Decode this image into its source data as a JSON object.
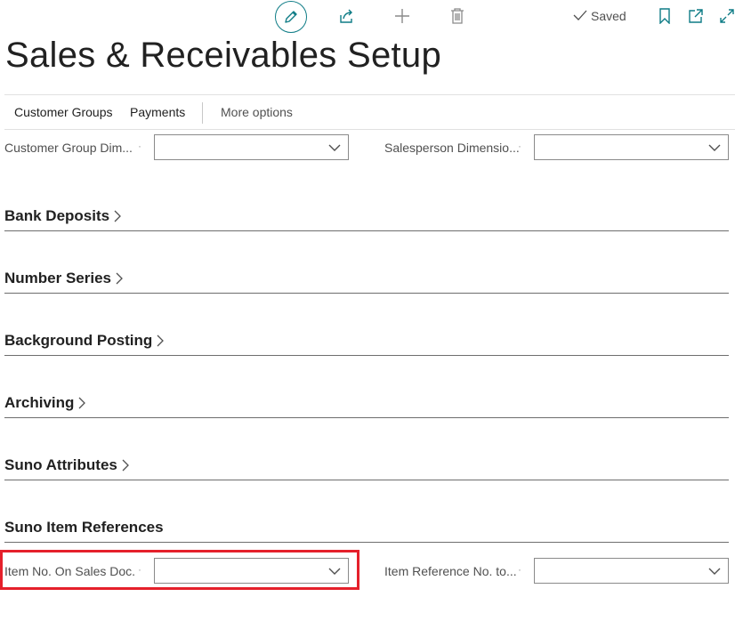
{
  "toolbar": {
    "edit_icon": "pencil-icon",
    "share_icon": "share-icon",
    "new_icon": "plus-icon",
    "delete_icon": "trash-icon",
    "saved_label": "Saved",
    "bookmark_icon": "bookmark-icon",
    "popout_icon": "open-in-new-window-icon",
    "expand_icon": "expand-icon"
  },
  "page_title": "Sales & Receivables Setup",
  "actions": {
    "customer_groups": "Customer Groups",
    "payments": "Payments",
    "more_options": "More options"
  },
  "fields_top": {
    "customer_group_dim_label": "Customer Group Dim...",
    "customer_group_dim_value": "",
    "salesperson_dim_label": "Salesperson Dimensio...",
    "salesperson_dim_value": ""
  },
  "sections": {
    "bank_deposits": "Bank Deposits",
    "number_series": "Number Series",
    "background_posting": "Background Posting",
    "archiving": "Archiving",
    "suno_attributes": "Suno Attributes",
    "suno_item_references": "Suno Item References"
  },
  "fields_bottom": {
    "item_no_label": "Item No. On Sales Doc.",
    "item_no_value": "",
    "item_ref_label": "Item Reference No. to...",
    "item_ref_value": ""
  },
  "colors": {
    "accent": "#0e7c86",
    "highlight": "#e5202b"
  }
}
